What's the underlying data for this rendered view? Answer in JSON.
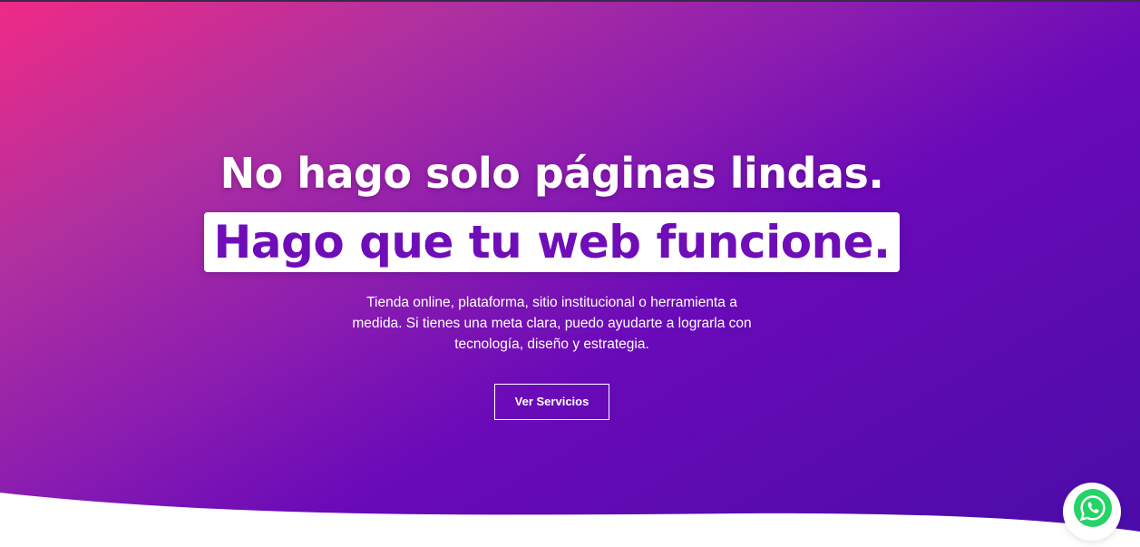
{
  "hero": {
    "headline": "No hago solo páginas lindas.",
    "highlight": "Hago que tu web funcione.",
    "description": "Tienda online, plataforma, sitio institucional o herramienta a medida. Si tienes una meta clara, puedo ayudarte a lograrla con tecnología, diseño y estrategia.",
    "cta_label": "Ver Servicios"
  },
  "colors": {
    "gradient_start": "#f02a86",
    "gradient_mid": "#6a0ab8",
    "gradient_end": "#4a0ca8",
    "highlight_text": "#6f0db8",
    "whatsapp_green": "#25d366"
  },
  "floating": {
    "icon": "whatsapp-icon"
  }
}
